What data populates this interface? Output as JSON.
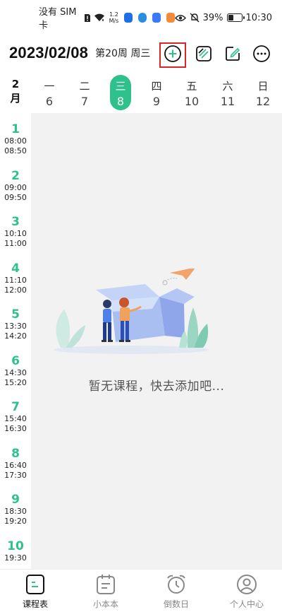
{
  "status_bar": {
    "carrier": "没有 SIM 卡",
    "net_speed_value": "1.2",
    "net_speed_unit": "M/s",
    "battery": "39%",
    "time": "10:30"
  },
  "header": {
    "date": "2023/02/08",
    "week_info": "第20周 周三"
  },
  "week_row": {
    "month_num": "2",
    "month_char": "月",
    "days": [
      {
        "weekday": "一",
        "date": "6"
      },
      {
        "weekday": "二",
        "date": "7"
      },
      {
        "weekday": "三",
        "date": "8"
      },
      {
        "weekday": "四",
        "date": "9"
      },
      {
        "weekday": "五",
        "date": "10"
      },
      {
        "weekday": "六",
        "date": "11"
      },
      {
        "weekday": "日",
        "date": "12"
      }
    ],
    "today_index": 2
  },
  "periods": [
    {
      "num": "1",
      "start": "08:00",
      "end": "08:50"
    },
    {
      "num": "2",
      "start": "09:00",
      "end": "09:50"
    },
    {
      "num": "3",
      "start": "10:10",
      "end": "11:00"
    },
    {
      "num": "4",
      "start": "11:10",
      "end": "12:00"
    },
    {
      "num": "5",
      "start": "13:30",
      "end": "14:20"
    },
    {
      "num": "6",
      "start": "14:30",
      "end": "15:20"
    },
    {
      "num": "7",
      "start": "15:40",
      "end": "16:30"
    },
    {
      "num": "8",
      "start": "16:40",
      "end": "17:30"
    },
    {
      "num": "9",
      "start": "18:30",
      "end": "19:20"
    },
    {
      "num": "10",
      "start": "19:30",
      "end": ""
    }
  ],
  "empty_state": {
    "message": "暂无课程，快去添加吧..."
  },
  "bottom_nav": {
    "items": [
      {
        "label": "课程表",
        "icon": "schedule-icon"
      },
      {
        "label": "小本本",
        "icon": "notebook-icon"
      },
      {
        "label": "倒数日",
        "icon": "alarm-clock-icon"
      },
      {
        "label": "个人中心",
        "icon": "profile-icon"
      }
    ],
    "active_index": 0
  },
  "colors": {
    "accent": "#2fc18b",
    "highlight_border": "#d9262a",
    "background": "#f2f2f2"
  }
}
